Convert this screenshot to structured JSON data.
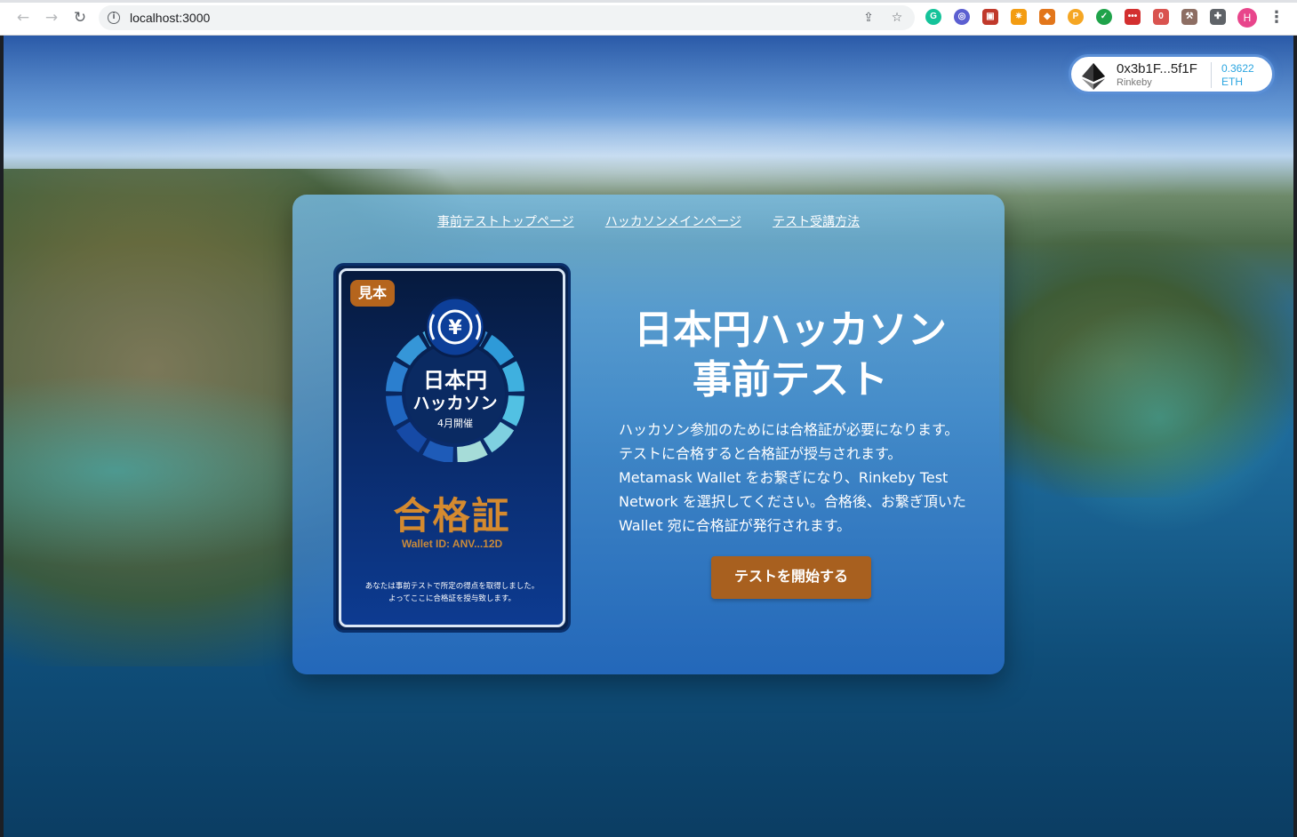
{
  "browser": {
    "url": "localhost:3000",
    "nav_back": "←",
    "nav_forward": "→",
    "nav_reload": "↻",
    "share_icon": "⇪",
    "star_icon": "☆",
    "info_icon": "i",
    "profile_initial": "H",
    "menu_icon": "⋮",
    "extensions": [
      {
        "name": "grammarly-icon",
        "glyph": "G",
        "color": "#15c39a"
      },
      {
        "name": "ext-circle-icon",
        "glyph": "◎",
        "color": "#5b5fd1"
      },
      {
        "name": "ext-red-icon",
        "glyph": "▣",
        "color": "#c0392b"
      },
      {
        "name": "ext-spark-icon",
        "glyph": "✷",
        "color": "#f39c12"
      },
      {
        "name": "metamask-icon",
        "glyph": "◆",
        "color": "#e2761b"
      },
      {
        "name": "ext-orange-icon",
        "glyph": "P",
        "color": "#f5a623"
      },
      {
        "name": "ext-check-icon",
        "glyph": "✓",
        "color": "#1fa34a"
      },
      {
        "name": "ext-dots-icon",
        "glyph": "•••",
        "color": "#d32f2f"
      },
      {
        "name": "ext-badge-icon",
        "glyph": "0",
        "color": "#d9534f"
      },
      {
        "name": "ext-tool-icon",
        "glyph": "⚒",
        "color": "#8d6e63"
      },
      {
        "name": "puzzle-icon",
        "glyph": "✚",
        "color": "#5f6368"
      }
    ]
  },
  "wallet": {
    "address": "0x3b1F...5f1F",
    "network": "Rinkeby",
    "balance": "0.3622",
    "unit": "ETH"
  },
  "nav": {
    "links": [
      "事前テストトップページ",
      "ハッカソンメインページ",
      "テスト受講方法"
    ]
  },
  "certificate": {
    "sample_label": "見本",
    "logo_line1": "日本円",
    "logo_line2": "ハッカソン",
    "logo_line3": "4月開催",
    "yen_symbol": "¥",
    "title": "合格証",
    "wallet_id": "Wallet ID: ANV...12D",
    "message_line1": "あなたは事前テストで所定の得点を取得しました。",
    "message_line2": "よってここに合格証を授与致します。"
  },
  "hero": {
    "title_line1": "日本円ハッカソン",
    "title_line2": "事前テスト",
    "description": "ハッカソン参加のためには合格証が必要になります。テストに合格すると合格証が授与されます。Metamask Wallet をお繋ぎになり、Rinkeby Test Network を選択してください。合格後、お繋ぎ頂いた Wallet 宛に合格証が発行されます。",
    "start_button": "テストを開始する"
  },
  "colors": {
    "accent_button": "#a8601f",
    "cert_title": "#d48a2f",
    "wallet_balance": "#2aa5e0"
  }
}
